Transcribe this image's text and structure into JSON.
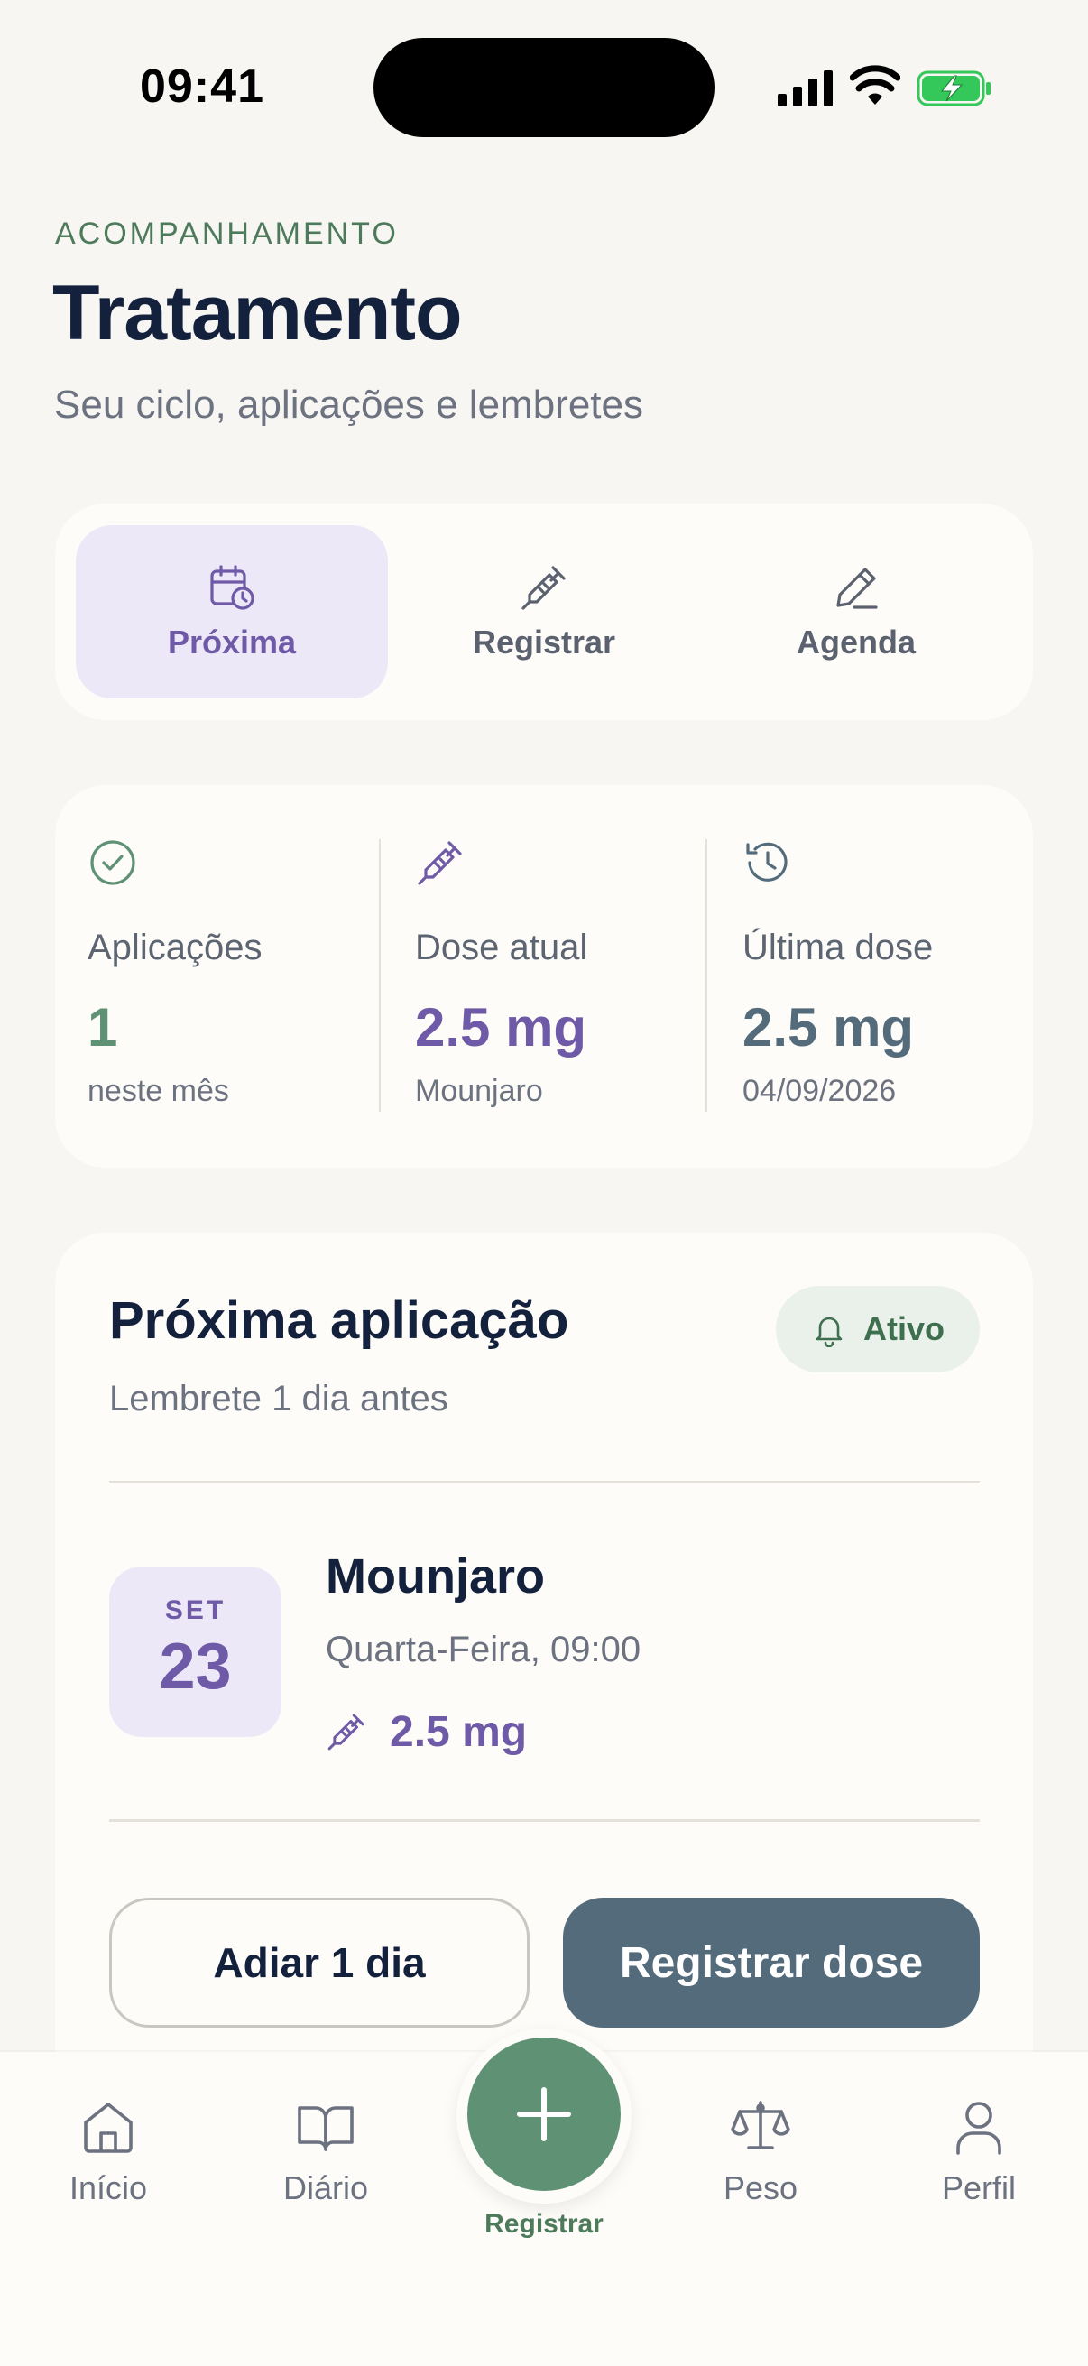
{
  "status_bar": {
    "time": "09:41"
  },
  "header": {
    "eyebrow": "ACOMPANHAMENTO",
    "title": "Tratamento",
    "subtitle": "Seu ciclo, aplicações e lembretes"
  },
  "tabs": [
    {
      "label": "Próxima",
      "icon": "calendar-clock-icon",
      "active": true
    },
    {
      "label": "Registrar",
      "icon": "syringe-icon",
      "active": false
    },
    {
      "label": "Agenda",
      "icon": "pencil-icon",
      "active": false
    }
  ],
  "stats": [
    {
      "icon": "check-circle-icon",
      "label": "Aplicações",
      "value": "1",
      "sub": "neste mês",
      "color": "#4E7A5C"
    },
    {
      "icon": "syringe-icon",
      "label": "Dose atual",
      "value": "2.5 mg",
      "sub": "Mounjaro",
      "color": "#6E5AA6"
    },
    {
      "icon": "history-icon",
      "label": "Última dose",
      "value": "2.5 mg",
      "sub": "04/09/2026",
      "color": "#536B7B"
    }
  ],
  "next_application": {
    "title": "Próxima aplicação",
    "subtitle": "Lembrete 1 dia antes",
    "badge": {
      "label": "Ativo",
      "icon": "bell-icon"
    },
    "date": {
      "month": "SET",
      "day": "23"
    },
    "medication": "Mounjaro",
    "when": "Quarta-Feira, 09:00",
    "dose": "2.5 mg",
    "postpone_label": "Adiar 1 dia",
    "register_label": "Registrar dose"
  },
  "bottom_nav": {
    "items": [
      {
        "label": "Início",
        "icon": "home-icon"
      },
      {
        "label": "Diário",
        "icon": "book-icon"
      },
      {
        "label": "Peso",
        "icon": "scale-icon"
      },
      {
        "label": "Perfil",
        "icon": "user-icon"
      }
    ],
    "fab_label": "Registrar"
  },
  "colors": {
    "accent_green": "#5F9174",
    "accent_purple": "#6E5AA6",
    "accent_slate": "#536B7B",
    "background": "#F7F6F2"
  }
}
